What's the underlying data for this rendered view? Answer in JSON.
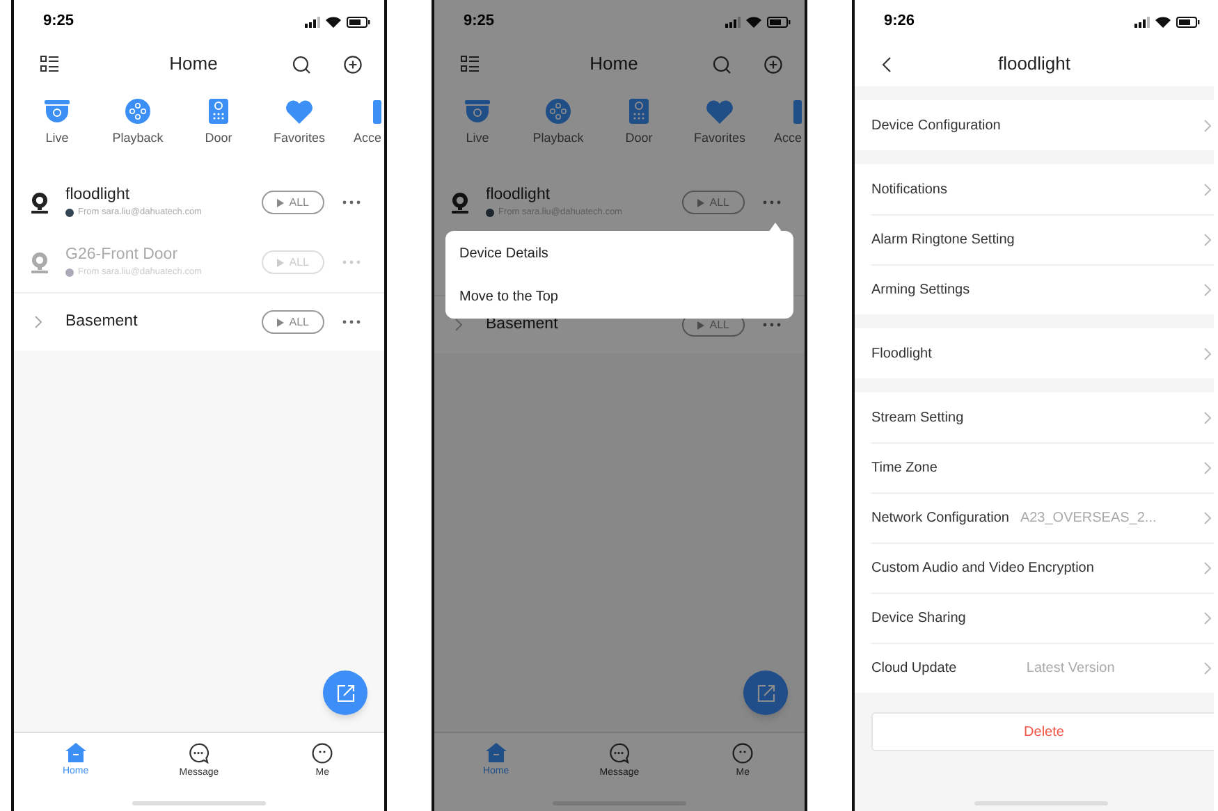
{
  "screens": [
    {
      "kind": "home",
      "time": "9:25",
      "title": "Home",
      "dimmed": false,
      "shortcuts": [
        {
          "kind": "live",
          "label": "Live"
        },
        {
          "kind": "playback",
          "label": "Playback"
        },
        {
          "kind": "door",
          "label": "Door"
        },
        {
          "kind": "favorites",
          "label": "Favorites"
        },
        {
          "kind": "partial",
          "label": "Acce"
        }
      ],
      "devices": [
        {
          "kind": "camera",
          "name": "floodlight",
          "source": "From sara.liu@dahuatech.com",
          "offline": false,
          "button": "ALL"
        },
        {
          "kind": "camera",
          "name": "G26-Front Door",
          "source": "From sara.liu@dahuatech.com",
          "offline": true,
          "button": "ALL"
        },
        {
          "kind": "group",
          "name": "Basement",
          "button": "ALL"
        }
      ],
      "tabs": [
        {
          "kind": "home",
          "label": "Home",
          "selected": true
        },
        {
          "kind": "message",
          "label": "Message",
          "selected": false
        },
        {
          "kind": "me",
          "label": "Me",
          "selected": false
        }
      ]
    },
    {
      "kind": "home",
      "time": "9:25",
      "title": "Home",
      "dimmed": true,
      "shortcuts": [
        {
          "kind": "live",
          "label": "Live"
        },
        {
          "kind": "playback",
          "label": "Playback"
        },
        {
          "kind": "door",
          "label": "Door"
        },
        {
          "kind": "favorites",
          "label": "Favorites"
        },
        {
          "kind": "partial",
          "label": "Acce"
        }
      ],
      "devices": [
        {
          "kind": "camera",
          "name": "floodlight",
          "source": "From sara.liu@dahuatech.com",
          "offline": false,
          "button": "ALL"
        },
        {
          "kind": "menu",
          "items": [
            "Device Details",
            "Move to the Top"
          ]
        },
        {
          "kind": "group",
          "name": "Basement",
          "button": "ALL"
        }
      ],
      "tabs": [
        {
          "kind": "home",
          "label": "Home",
          "selected": true
        },
        {
          "kind": "message",
          "label": "Message",
          "selected": false
        },
        {
          "kind": "me",
          "label": "Me",
          "selected": false
        }
      ]
    },
    {
      "kind": "settings",
      "time": "9:26",
      "title": "floodlight",
      "groups": [
        {
          "rows": [
            {
              "label": "Device Configuration"
            }
          ]
        },
        {
          "rows": [
            {
              "label": "Notifications"
            },
            {
              "label": "Alarm Ringtone Setting"
            },
            {
              "label": "Arming Settings"
            }
          ]
        },
        {
          "rows": [
            {
              "label": "Floodlight"
            }
          ]
        },
        {
          "rows": [
            {
              "label": "Stream Setting"
            },
            {
              "label": "Time Zone"
            },
            {
              "label": "Network Configuration",
              "value": "A23_OVERSEAS_2..."
            },
            {
              "label": "Custom Audio and Video Encryption"
            },
            {
              "label": "Device Sharing"
            },
            {
              "label": "Cloud Update",
              "value": "Latest Version"
            }
          ]
        }
      ],
      "delete": "Delete"
    }
  ]
}
